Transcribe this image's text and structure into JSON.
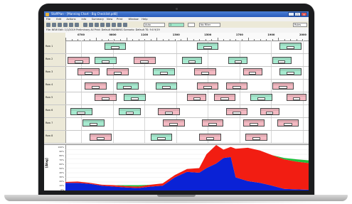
{
  "window": {
    "title": "StaffPlan - [Manning Chart - Big Checklist.pd8]",
    "minimize_glyph": "_",
    "maximize_glyph": "□",
    "close_glyph": "x"
  },
  "menu": [
    "File",
    "Edit",
    "Actions",
    "Info",
    "Summary",
    "View",
    "Print",
    "Window",
    "Help"
  ],
  "toolbar": {
    "zoom_value": "Auto",
    "field_value": "1",
    "filter_value": "No Filter",
    "right_label": "Rules"
  },
  "info_bar": {
    "text": "File: NEW   Edit: 1/1/2019 Preliminary   All   Print: Default MANNING Scenario: Default   TS: 9:0 9/19"
  },
  "colors": {
    "pink": "#f3b9c2",
    "green": "#a6eacf",
    "chart_blue": "#0a22d6",
    "chart_red": "#f21d12",
    "chart_green": "#1fbf3c"
  },
  "gantt": {
    "time_labels": [
      "0700",
      "0800",
      "1100",
      "1300",
      "1500",
      "1700",
      "1900",
      "2000"
    ],
    "rows": [
      {
        "label": "Row 1",
        "bars": [
          {
            "color": "green",
            "start": 0.16,
            "end": 0.25
          },
          {
            "color": "green",
            "start": 0.54,
            "end": 0.63
          },
          {
            "color": "green",
            "start": 0.88,
            "end": 0.97
          }
        ]
      },
      {
        "label": "Row 2",
        "bars": [
          {
            "color": "pink",
            "start": 0.01,
            "end": 0.1
          },
          {
            "color": "green",
            "start": 0.12,
            "end": 0.21
          },
          {
            "color": "pink",
            "start": 0.28,
            "end": 0.37
          },
          {
            "color": "green",
            "start": 0.48,
            "end": 0.56
          },
          {
            "color": "green",
            "start": 0.67,
            "end": 0.75
          },
          {
            "color": "green",
            "start": 0.85,
            "end": 0.93
          }
        ]
      },
      {
        "label": "Row 3",
        "bars": [
          {
            "color": "pink",
            "start": 0.05,
            "end": 0.14
          },
          {
            "color": "pink",
            "start": 0.17,
            "end": 0.26
          },
          {
            "color": "green",
            "start": 0.36,
            "end": 0.45
          },
          {
            "color": "pink",
            "start": 0.53,
            "end": 0.62
          },
          {
            "color": "pink",
            "start": 0.73,
            "end": 0.81
          },
          {
            "color": "green",
            "start": 0.88,
            "end": 0.97
          }
        ]
      },
      {
        "label": "Row 4",
        "bars": [
          {
            "color": "pink",
            "start": 0.08,
            "end": 0.17
          },
          {
            "color": "green",
            "start": 0.21,
            "end": 0.3
          },
          {
            "color": "green",
            "start": 0.37,
            "end": 0.46
          },
          {
            "color": "pink",
            "start": 0.54,
            "end": 0.63
          },
          {
            "color": "pink",
            "start": 0.66,
            "end": 0.75
          },
          {
            "color": "pink",
            "start": 0.85,
            "end": 0.94
          }
        ]
      },
      {
        "label": "Row 5",
        "bars": [
          {
            "color": "pink",
            "start": 0.12,
            "end": 0.21
          },
          {
            "color": "green",
            "start": 0.24,
            "end": 0.33
          },
          {
            "color": "pink",
            "start": 0.5,
            "end": 0.58
          },
          {
            "color": "pink",
            "start": 0.61,
            "end": 0.7
          },
          {
            "color": "green",
            "start": 0.76,
            "end": 0.85
          },
          {
            "color": "pink",
            "start": 0.91,
            "end": 0.99
          }
        ]
      },
      {
        "label": "Row 6",
        "bars": [
          {
            "color": "green",
            "start": 0.02,
            "end": 0.11
          },
          {
            "color": "green",
            "start": 0.22,
            "end": 0.31
          },
          {
            "color": "pink",
            "start": 0.38,
            "end": 0.47
          },
          {
            "color": "pink",
            "start": 0.66,
            "end": 0.75
          },
          {
            "color": "pink",
            "start": 0.8,
            "end": 0.88
          }
        ]
      },
      {
        "label": "Row 7",
        "bars": [
          {
            "color": "green",
            "start": 0.07,
            "end": 0.16
          },
          {
            "color": "pink",
            "start": 0.4,
            "end": 0.49
          },
          {
            "color": "pink",
            "start": 0.56,
            "end": 0.65
          },
          {
            "color": "pink",
            "start": 0.73,
            "end": 0.82
          },
          {
            "color": "pink",
            "start": 0.87,
            "end": 0.96
          }
        ]
      },
      {
        "label": "Row 8",
        "bars": [
          {
            "color": "pink",
            "start": 0.1,
            "end": 0.19
          },
          {
            "color": "green",
            "start": 0.35,
            "end": 0.44
          },
          {
            "color": "pink",
            "start": 0.55,
            "end": 0.64
          },
          {
            "color": "pink",
            "start": 0.74,
            "end": 0.83
          }
        ]
      }
    ]
  },
  "plot": {
    "y_title": "[Alog]",
    "y_ticks": [
      "100%",
      "90%",
      "80%",
      "70%",
      "60%",
      "50%",
      "40%",
      "30%",
      "20%",
      "10%",
      "0%"
    ],
    "series": {
      "x": [
        0,
        0.05,
        0.1,
        0.15,
        0.2,
        0.25,
        0.3,
        0.35,
        0.4,
        0.45,
        0.5,
        0.55,
        0.58,
        0.62,
        0.65,
        0.68,
        0.7,
        0.75,
        0.8,
        0.85,
        0.9,
        0.95,
        1.0
      ],
      "blue": [
        0.18,
        0.18,
        0.16,
        0.12,
        0.1,
        0.08,
        0.07,
        0.1,
        0.12,
        0.3,
        0.42,
        0.4,
        0.5,
        0.6,
        0.72,
        0.74,
        0.3,
        0.22,
        0.18,
        0.12,
        0.05,
        0.04,
        0.03
      ],
      "red": [
        0.02,
        0.03,
        0.02,
        0.02,
        0.03,
        0.03,
        0.03,
        0.04,
        0.05,
        0.05,
        0.06,
        0.1,
        0.3,
        0.4,
        0.18,
        0.22,
        0.62,
        0.72,
        0.7,
        0.66,
        0.64,
        0.6,
        0.58
      ],
      "green": [
        0.0,
        0.0,
        0.0,
        0.0,
        0.0,
        0.02,
        0.03,
        0.0,
        0.0,
        0.0,
        0.0,
        0.0,
        0.0,
        0.0,
        0.0,
        0.0,
        0.0,
        0.0,
        0.0,
        0.0,
        0.03,
        0.05,
        0.06
      ]
    }
  }
}
